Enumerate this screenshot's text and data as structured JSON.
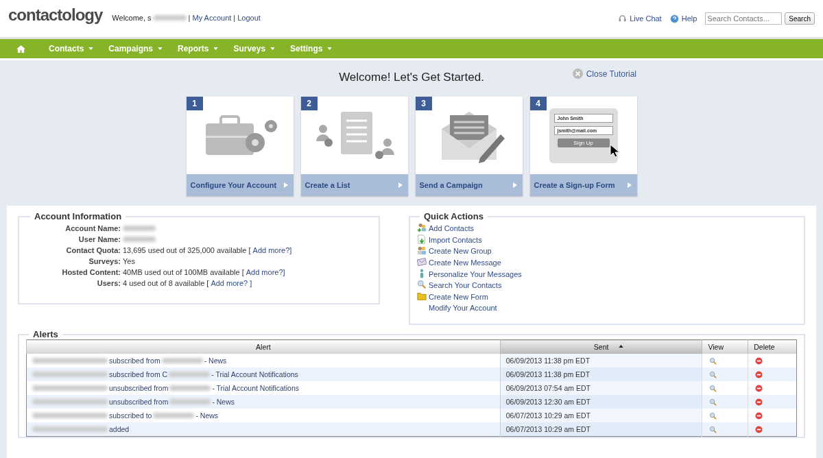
{
  "header": {
    "logo": "contactology",
    "welcome": "Welcome, s",
    "separator": "|",
    "links": [
      "My Account",
      "Logout"
    ],
    "live_chat": "Live Chat",
    "help": "Help",
    "search": {
      "placeholder": "Search Contacts..."
    },
    "search_button": "Search"
  },
  "nav": {
    "items": [
      {
        "label": "Contacts"
      },
      {
        "label": "Campaigns"
      },
      {
        "label": "Reports"
      },
      {
        "label": "Surveys"
      },
      {
        "label": "Settings"
      }
    ]
  },
  "tutorial": {
    "title": "Welcome! Let's Get Started.",
    "close": "Close Tutorial",
    "steps": [
      {
        "number": "1",
        "label": "Configure Your Account",
        "kind": "toolbox"
      },
      {
        "number": "2",
        "label": "Create a List",
        "kind": "list"
      },
      {
        "number": "3",
        "label": "Send a Campaign",
        "kind": "envelope"
      },
      {
        "number": "4",
        "label": "Create a Sign-up Form",
        "kind": "form",
        "form_name": "John Smith",
        "form_email": "jsmith@mail.com",
        "form_button": "Sign Up"
      }
    ]
  },
  "account_information": {
    "title": "Account Information",
    "rows": [
      {
        "label": "Account Name:",
        "value": "",
        "link": ""
      },
      {
        "label": "User Name:",
        "value": "",
        "link": ""
      },
      {
        "label": "Contact Quota:",
        "value": "13,695 used out of 325,000 available [",
        "link": "Add more?]"
      },
      {
        "label": "Surveys:",
        "value": "Yes",
        "link": ""
      },
      {
        "label": "Hosted Content:",
        "value": "40MB used out of 100MB available [",
        "link": "Add more?]"
      },
      {
        "label": "Users:",
        "value": "4 used out of 8 available [",
        "link": "Add more? ]"
      }
    ]
  },
  "quick_actions": {
    "title": "Quick Actions",
    "items": [
      {
        "label": "Add Contacts",
        "kind": "add-contacts"
      },
      {
        "label": "Import Contacts",
        "kind": "import"
      },
      {
        "label": "Create New Group",
        "kind": "group"
      },
      {
        "label": "Create New Message",
        "kind": "message"
      },
      {
        "label": "Personalize Your Messages",
        "kind": "person"
      },
      {
        "label": "Search Your Contacts",
        "kind": "search"
      },
      {
        "label": "Create New Form",
        "kind": "folder"
      },
      {
        "label": "Modify Your Account",
        "kind": "none"
      }
    ]
  },
  "alerts": {
    "title": "Alerts",
    "columns": [
      {
        "label": "Alert",
        "sorted": false
      },
      {
        "label": "Sent",
        "sorted": true
      },
      {
        "label": "View",
        "sorted": false
      },
      {
        "label": "Delete",
        "sorted": false
      }
    ],
    "rows": [
      {
        "action": "subscribed from",
        "suffix": "- News",
        "sent": "06/09/2013 11:38 pm EDT"
      },
      {
        "action": "subscribed from C",
        "suffix": "- Trial Account Notifications",
        "sent": "06/09/2013 11:38 pm EDT"
      },
      {
        "action": "unsubscribed from",
        "suffix": "- Trial Account Notifications",
        "sent": "06/09/2013 07:54 am EDT"
      },
      {
        "action": "unsubscribed from",
        "suffix": "- News",
        "sent": "06/09/2013 12:30 am EDT"
      },
      {
        "action": "subscribed to",
        "suffix": "- News",
        "sent": "06/07/2013 10:29 am EDT"
      },
      {
        "action": "added",
        "suffix": "",
        "sent": "06/07/2013 10:29 am EDT"
      }
    ]
  }
}
